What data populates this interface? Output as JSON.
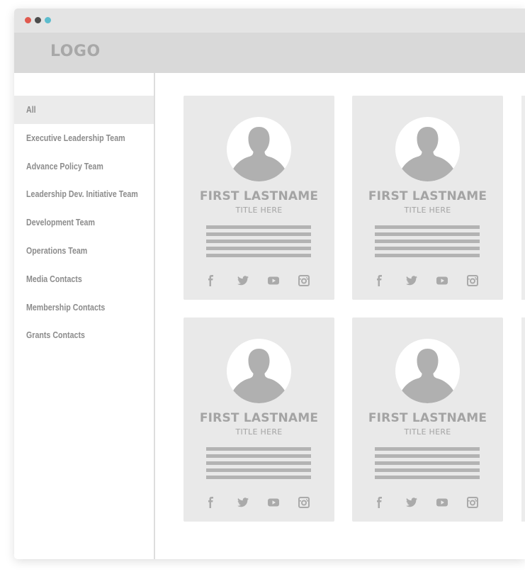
{
  "window": {
    "controls": [
      {
        "name": "close",
        "color": "#e05a4f"
      },
      {
        "name": "minimize",
        "color": "#4c4c4c"
      },
      {
        "name": "maximize",
        "color": "#5cbccd"
      }
    ]
  },
  "header": {
    "logo": "LOGO"
  },
  "sidebar": {
    "items": [
      {
        "label": "All",
        "active": true
      },
      {
        "label": "Executive Leadership Team",
        "active": false
      },
      {
        "label": "Advance Policy Team",
        "active": false
      },
      {
        "label": "Leadership Dev. Initiative Team",
        "active": false
      },
      {
        "label": "Development Team",
        "active": false
      },
      {
        "label": "Operations Team",
        "active": false
      },
      {
        "label": "Media Contacts",
        "active": false
      },
      {
        "label": "Membership Contacts",
        "active": false
      },
      {
        "label": "Grants Contacts",
        "active": false
      }
    ]
  },
  "cards": [
    {
      "name": "FIRST LASTNAME",
      "title": "TITLE HERE"
    },
    {
      "name": "FIRST LASTNAME",
      "title": "TITLE HERE"
    },
    {
      "name": "FIRST LASTNAME",
      "title": "TITLE HERE"
    },
    {
      "name": "FIRST LASTNAME",
      "title": "TITLE HERE"
    }
  ],
  "social_icons": [
    "facebook-icon",
    "twitter-icon",
    "youtube-icon",
    "instagram-icon"
  ],
  "colors": {
    "card_bg": "#e9e9e9",
    "text_gray": "#a4a4a4",
    "placeholder_line": "#b3b3b3",
    "active_nav_bg": "#ebebeb"
  }
}
